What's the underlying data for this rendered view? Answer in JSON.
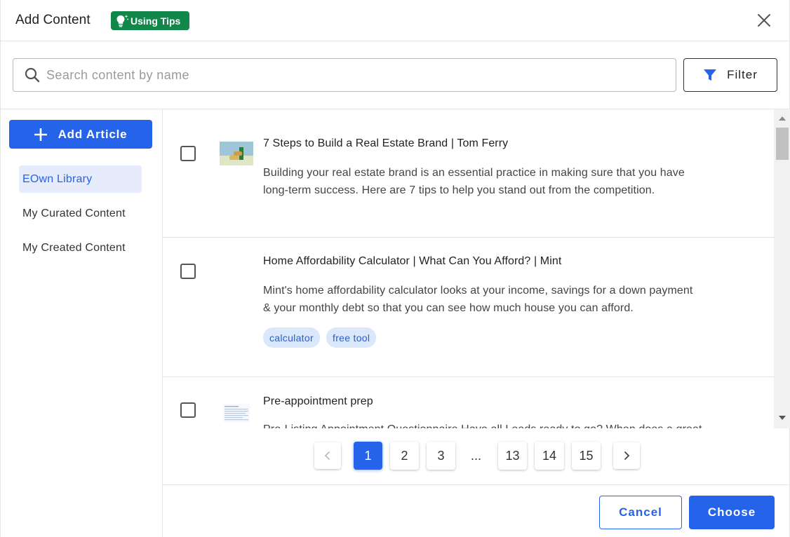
{
  "header": {
    "title": "Add Content",
    "tips_label": "Using Tips",
    "tips_color": "#11874a"
  },
  "search": {
    "placeholder": "Search content by name",
    "value": "",
    "filter_label": "Filter"
  },
  "sidebar": {
    "add_article_label": "Add Article",
    "items": [
      {
        "label": "EOwn Library",
        "active": true
      },
      {
        "label": "My Curated Content",
        "active": false
      },
      {
        "label": "My Created Content",
        "active": false
      }
    ]
  },
  "content": {
    "items": [
      {
        "title": "7 Steps to Build a Real Estate Brand | Tom Ferry",
        "desc_line1": "Building your real estate brand is an essential practice in making sure that you have",
        "desc_line2": "long-term success. Here are 7 tips to help you stand out from the competition.",
        "tags": []
      },
      {
        "title": "Home Affordability Calculator | What Can You Afford? | Mint",
        "desc_line1": "Mint's home affordability calculator looks at your income, savings for a down payment",
        "desc_line2": "& your monthly debt so that you can see how much house you can afford.",
        "tags": [
          "calculator",
          "free tool"
        ]
      },
      {
        "title": "Pre-appointment prep",
        "desc_line1": "Pre-Listing Appointment Questionnaire Have all Leads ready to go? When does a great",
        "desc_line2": "",
        "tags": []
      }
    ]
  },
  "pagination": {
    "pages": [
      "1",
      "2",
      "3",
      "13",
      "14",
      "15"
    ],
    "ellipsis": "...",
    "current": "1"
  },
  "footer": {
    "cancel_label": "Cancel",
    "choose_label": "Choose"
  },
  "colors": {
    "primary": "#2563eb",
    "tag_bg": "#dbe8fb",
    "active_nav_bg": "#e6ecfb"
  }
}
